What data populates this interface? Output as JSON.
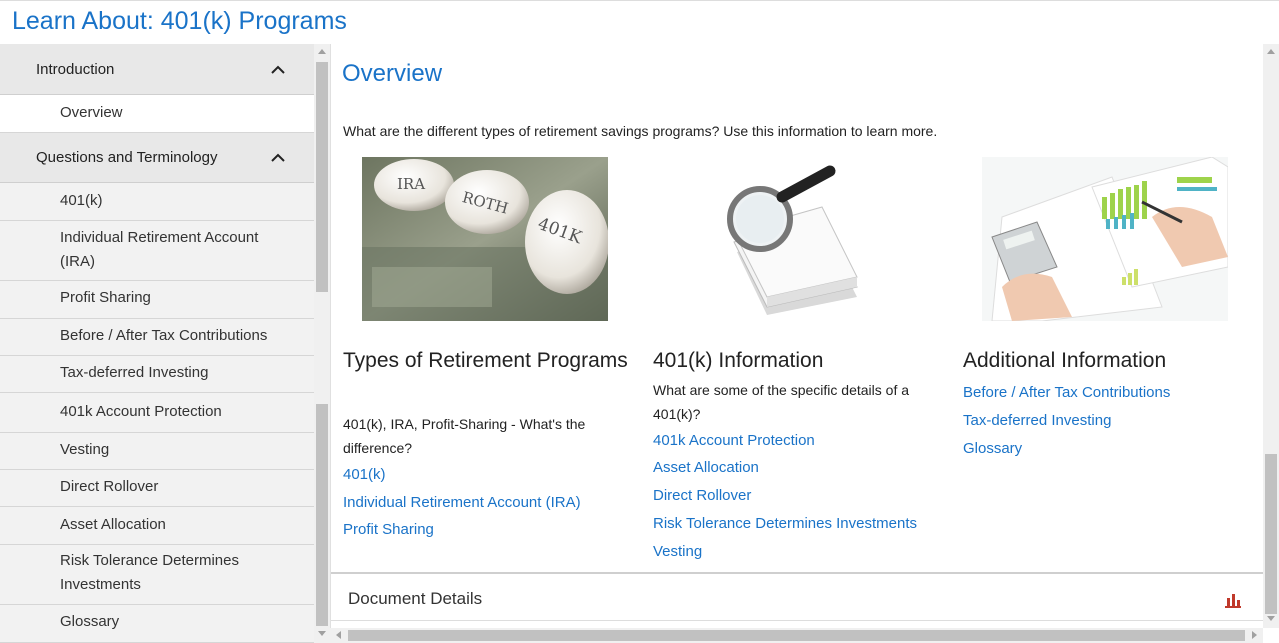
{
  "header": {
    "title": "Learn About: 401(k) Programs"
  },
  "sidebar": {
    "sections": [
      {
        "label": "Introduction"
      },
      {
        "label": "Questions and Terminology"
      }
    ],
    "intro_items": [
      {
        "label": "Overview"
      }
    ],
    "items": [
      {
        "label": "401(k)"
      },
      {
        "label": "Individual Retirement Account (IRA)"
      },
      {
        "label": "Profit Sharing"
      },
      {
        "label": "Before / After Tax Contributions"
      },
      {
        "label": "Tax-deferred Investing"
      },
      {
        "label": "401k Account Protection"
      },
      {
        "label": "Vesting"
      },
      {
        "label": "Direct Rollover"
      },
      {
        "label": "Asset Allocation"
      },
      {
        "label": "Risk Tolerance Determines Investments"
      },
      {
        "label": "Glossary"
      }
    ]
  },
  "main": {
    "title": "Overview",
    "intro": "What are the different types of retirement savings programs? Use this information to learn more.",
    "columns": [
      {
        "image": "retirement-eggs-image",
        "image_labels": [
          "IRA",
          "ROTH",
          "401K"
        ],
        "title": "Types of Retirement Programs",
        "text": "401(k), IRA, Profit-Sharing - What's the difference?",
        "links": [
          "401(k)",
          "Individual Retirement Account (IRA)",
          "Profit Sharing"
        ]
      },
      {
        "image": "magnifying-glass-books-image",
        "title": "401(k) Information",
        "text": "What are some of the specific details of a 401(k)?",
        "links": [
          "401k Account Protection",
          "Asset Allocation",
          "Direct Rollover",
          "Risk Tolerance Determines Investments",
          "Vesting"
        ]
      },
      {
        "image": "financial-charts-calculator-image",
        "title": "Additional Information",
        "text": "",
        "links": [
          "Before / After Tax Contributions",
          "Tax-deferred Investing",
          "Glossary"
        ]
      }
    ],
    "document_details": {
      "label": "Document Details",
      "icon": "bar-chart-icon"
    }
  },
  "colors": {
    "accent": "#1a73c8",
    "sidebar_bg": "#f2f2f2",
    "section_bg": "#e8e8e8",
    "chart_icon": "#c0392b"
  }
}
